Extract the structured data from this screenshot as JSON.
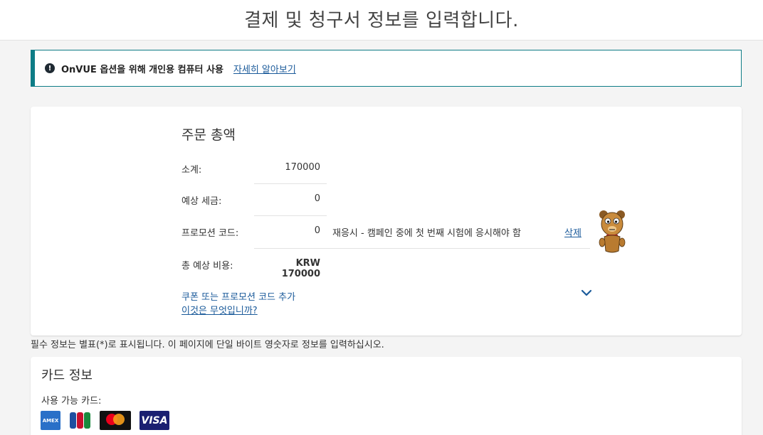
{
  "header": {
    "title": "결제 및 청구서 정보를 입력합니다."
  },
  "notice": {
    "icon": "info-icon",
    "text": "OnVUE 옵션을 위해 개인용 컴퓨터 사용",
    "link": "자세히 알아보기"
  },
  "summary": {
    "title": "주문 총액",
    "rows": {
      "subtotal": {
        "label": "소계:",
        "value": "170000"
      },
      "tax": {
        "label": "예상 세금:",
        "value": "0"
      },
      "promo": {
        "label": "프로모션 코드:",
        "value": "0",
        "description": "재응시 - 캠페인 중에 첫 번째 시험에 응시해야 함",
        "delete": "삭제"
      },
      "total": {
        "label": "총 예상 비용:",
        "value": "KRW 170000"
      }
    },
    "coupon_link": "쿠폰 또는 프로모션 코드 추가",
    "whatis_link": "이것은 무엇입니까?"
  },
  "required_note": "필수 정보는 별표(*)로 표시됩니다. 이 페이지에 단일 바이트 영숫자로 정보를 입력하십시오.",
  "card_info": {
    "title": "카드 정보",
    "available_label": "사용 가능 카드:",
    "cards": {
      "amex": "AMEX",
      "jcb": "JCB",
      "mastercard": "mastercard",
      "visa": "VISA"
    }
  },
  "colors": {
    "accent": "#0e7c86",
    "link": "#1a5a9a"
  }
}
